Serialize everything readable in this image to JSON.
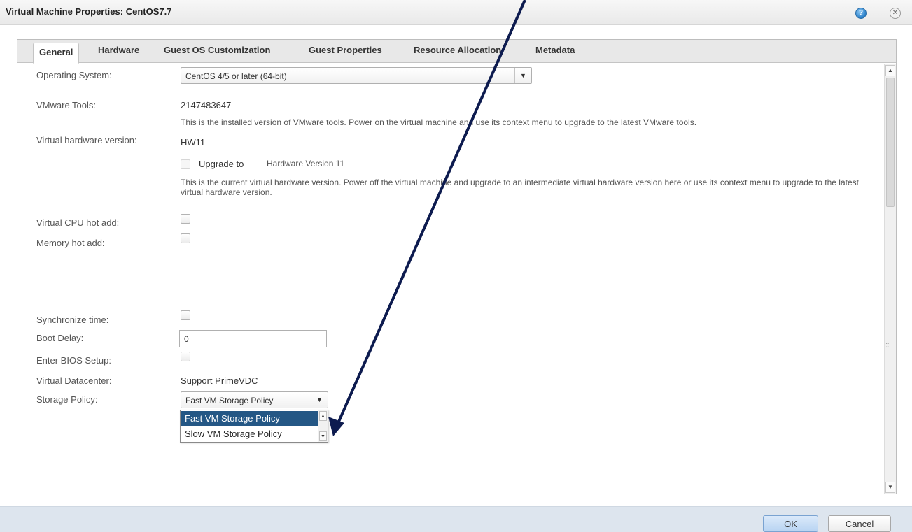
{
  "window": {
    "title": "Virtual Machine Properties: CentOS7.7",
    "help_icon": "?",
    "close_icon": "✕"
  },
  "tabs": [
    "General",
    "Hardware",
    "Guest OS Customization",
    "Guest Properties",
    "Resource Allocation",
    "Metadata"
  ],
  "active_tab": "General",
  "general": {
    "os_label": "Operating System:",
    "os_value": "CentOS 4/5 or later (64-bit)",
    "tools_label": "VMware Tools:",
    "tools_value": "2147483647",
    "tools_note": "This is the installed version of VMware tools. Power on the virtual machine and use its context menu to upgrade to the latest VMware tools.",
    "hw_label": "Virtual hardware version:",
    "hw_value": "HW11",
    "upgrade_label": "Upgrade to",
    "upgrade_target": "Hardware Version 11",
    "hw_note": "This is the current virtual hardware version. Power off the virtual machine and upgrade to an intermediate virtual hardware version here or use its context menu to upgrade to the latest virtual hardware version.",
    "cpu_hot_add_label": "Virtual CPU hot add:",
    "memory_hot_add_label": "Memory hot add:",
    "sync_time_label": "Synchronize time:",
    "boot_delay_label": "Boot Delay:",
    "boot_delay_value": "0",
    "bios_label": "Enter BIOS Setup:",
    "vdc_label": "Virtual Datacenter:",
    "vdc_value": "Support PrimeVDC",
    "storage_label": "Storage Policy:",
    "storage_value": "Fast VM Storage Policy",
    "storage_options": [
      "Fast VM Storage Policy",
      "Slow VM Storage Policy"
    ]
  },
  "footer": {
    "ok_label": "OK",
    "cancel_label": "Cancel"
  },
  "colors": {
    "accent_selected": "#245785",
    "annotation_arrow": "#0d1b4f",
    "footer_bg": "#dde5ee"
  }
}
